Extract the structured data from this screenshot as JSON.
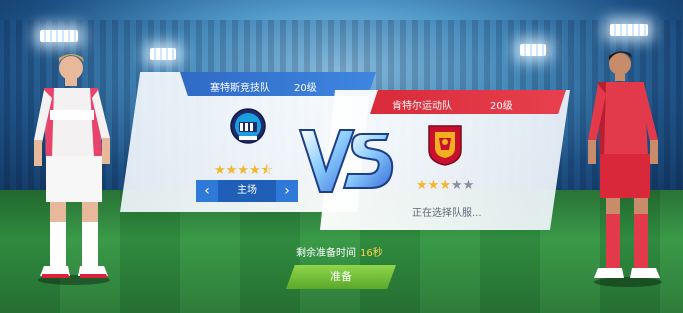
{
  "home": {
    "name": "塞特斯竞技队",
    "level": "20级",
    "stars_full": 4,
    "stars_half": 1,
    "stars_empty": 0,
    "kit_label": "主场",
    "crest_colors": [
      "#1d2b6b",
      "#ffffff",
      "#1aa0e0"
    ],
    "bar_color": "#2f6ac6"
  },
  "away": {
    "name": "肯特尔运动队",
    "level": "20级",
    "stars_full": 3,
    "stars_half": 0,
    "stars_empty": 2,
    "status": "正在选择队服...",
    "crest_colors": [
      "#c8102e",
      "#f2b01e"
    ],
    "bar_color": "#d92b3a"
  },
  "vs_label": "VS",
  "countdown": {
    "label": "剩余准备时间",
    "seconds": "16秒"
  },
  "ready_button": "准备",
  "icons": {
    "left_arrow": "chevron-left-icon",
    "right_arrow": "chevron-right-icon"
  }
}
